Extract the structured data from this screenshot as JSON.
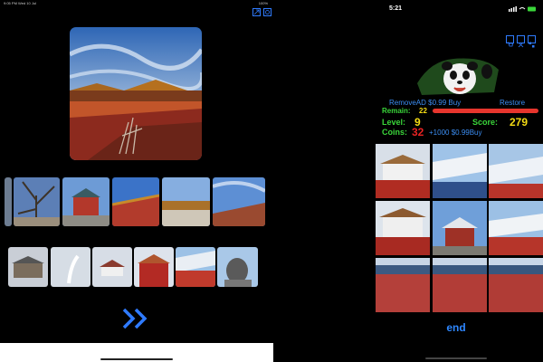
{
  "tablet": {
    "status_time": "9:05 PM",
    "status_date": "Wed 10 Jul",
    "status_battery": "100%",
    "toolbar": {
      "expand_icon": "expand-icon",
      "settings_icon": "settings-icon"
    },
    "hero_image": "forbidden-city-roofs-photo",
    "forward_icon": "double-chevron-right-icon",
    "accent": "#2f7bff"
  },
  "phone": {
    "status_time": "5:21",
    "status_icons": "signal wifi battery",
    "toolbar": {
      "cart_icon": "cart-icon",
      "expand_icon": "expand-icon",
      "grid_icon": "grid-icon"
    },
    "mascot": "panda-image",
    "remove_ad": "RemoveAD $0.99 Buy",
    "restore": "Restore",
    "remain_label": "Remain:",
    "remain_value": "22",
    "remain_fraction": 0.6,
    "level_label": "Level:",
    "level_value": "9",
    "score_label": "Score:",
    "score_value": "279",
    "coins_label": "Coins:",
    "coins_value": "32",
    "coins_offer": "+1000 $0.99Buy",
    "end_label": "end",
    "colors": {
      "blue": "#3b8df2",
      "green": "#3ad63a",
      "yellow": "#f5dc14",
      "red": "#e82323"
    }
  }
}
